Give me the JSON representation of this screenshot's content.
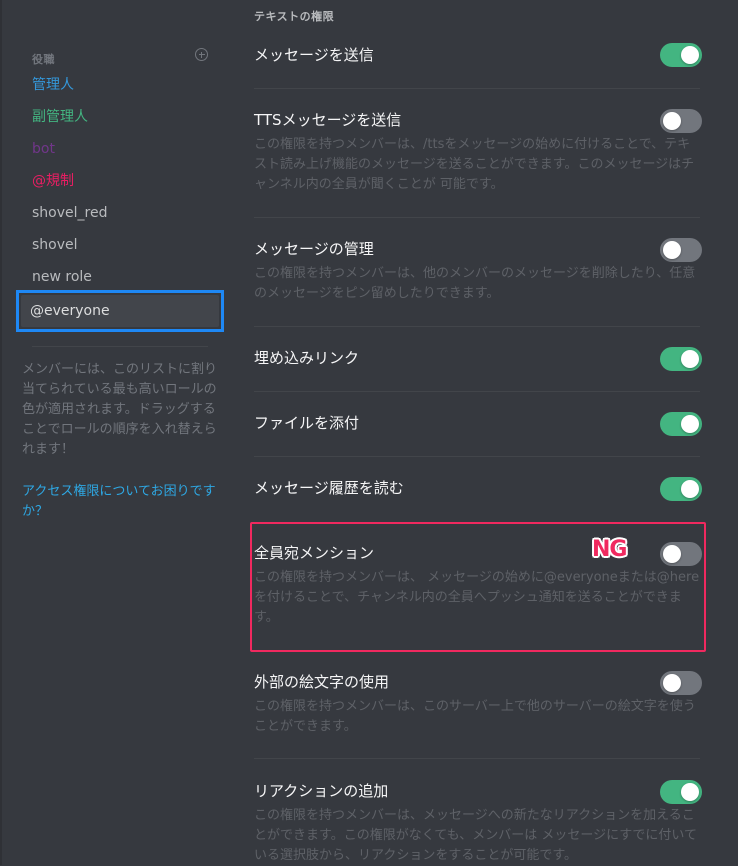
{
  "sidebar": {
    "roles_header": "役職",
    "add_role_icon": "plus-circle-icon",
    "roles": [
      {
        "name": "管理人",
        "color": "#3498db"
      },
      {
        "name": "副管理人",
        "color": "#43b581"
      },
      {
        "name": "bot",
        "color": "#71368a"
      },
      {
        "name": "@規制",
        "color": "#e91e63"
      },
      {
        "name": "shovel_red",
        "color": "#b9bbbe"
      },
      {
        "name": "shovel",
        "color": "#b9bbbe"
      },
      {
        "name": "new role",
        "color": "#b9bbbe"
      }
    ],
    "selected_role": "@everyone",
    "help_text": "メンバーには、このリストに割り当てられている最も高いロールの色が適用されます。ドラッグすることでロールの順序を入れ替えられます！",
    "help_link": "アクセス権限についてお困りですか？"
  },
  "main": {
    "section_title": "テキストの権限",
    "permissions": [
      {
        "title": "メッセージを送信",
        "description": "",
        "enabled": true
      },
      {
        "title": "TTSメッセージを送信",
        "description": "この権限を持つメンバーは、/ttsをメッセージの始めに付けることで、テキスト読み上げ機能のメッセージを送ることができます。このメッセージはチャンネル内の全員が聞くことが 可能です。",
        "enabled": false
      },
      {
        "title": "メッセージの管理",
        "description": "この権限を持つメンバーは、他のメンバーのメッセージを削除したり、任意のメッセージをピン留めしたりできます。",
        "enabled": false
      },
      {
        "title": "埋め込みリンク",
        "description": "",
        "enabled": true
      },
      {
        "title": "ファイルを添付",
        "description": "",
        "enabled": true
      },
      {
        "title": "メッセージ履歴を読む",
        "description": "",
        "enabled": true
      },
      {
        "title": "全員宛メンション",
        "description": "この権限を持つメンバーは、 メッセージの始めに@everyoneまたは@hereを付けることで、チャンネル内の全員へプッシュ通知を送ることができます。",
        "enabled": false
      },
      {
        "title": "外部の絵文字の使用",
        "description": "この権限を持つメンバーは、このサーバー上で他のサーバーの絵文字を使うことができます。",
        "enabled": false
      },
      {
        "title": "リアクションの追加",
        "description": "この権限を持つメンバーは、メッセージへの新たなリアクションを加えることができます。この権限がなくても、メンバーは メッセージにすでに付いている選択肢から、リアクションをすることが可能です。",
        "enabled": true
      }
    ]
  },
  "annotation": {
    "label": "NG",
    "color": "#f0295f"
  },
  "colors": {
    "background": "#36393f",
    "toggle_on": "#43b581",
    "toggle_off": "#72767d",
    "selection_border": "#1e88f5",
    "link": "#2ea8e4"
  }
}
